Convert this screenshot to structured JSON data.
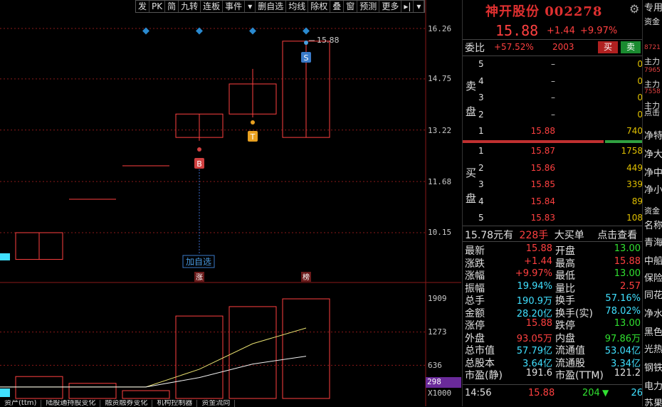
{
  "toolbar": {
    "items": [
      "发",
      "PK",
      "简",
      "九转",
      "连板",
      "事件",
      "▾",
      "删自选",
      "均线",
      "除权",
      "叠",
      "窗",
      "预测",
      "更多",
      "▸|",
      "▾"
    ]
  },
  "chart": {
    "y_labels": [
      "16.26",
      "14.75",
      "13.22",
      "11.68",
      "10.15"
    ],
    "vol_labels": [
      "1909",
      "1273",
      "636"
    ],
    "vol_current": "298",
    "vol_unit": "X1000",
    "high_marker": "15.88",
    "add_watch_label": "加自选",
    "zhang_label": "涨",
    "bang_label": "榜",
    "b_marker": "B",
    "t_marker": "T",
    "s_marker": "S"
  },
  "chart_data": {
    "type": "candlestick",
    "candles": [
      {
        "open": 10.15,
        "close": 9.35,
        "high": 10.15,
        "low": 9.35
      },
      {
        "open": 11.15,
        "close": 11.15,
        "high": 11.15,
        "low": 11.15
      },
      {
        "open": 12.15,
        "close": 12.15,
        "high": 12.15,
        "low": 12.15
      },
      {
        "open": 13.0,
        "close": 13.7,
        "high": 13.7,
        "low": 12.9
      },
      {
        "open": 13.7,
        "close": 14.6,
        "high": 15.05,
        "low": 13.6
      },
      {
        "open": 13.0,
        "close": 15.88,
        "high": 15.88,
        "low": 13.0
      }
    ],
    "volume": [
      420,
      290,
      150,
      1580,
      1760,
      1909
    ],
    "ma_vol_1": [
      220,
      220,
      220,
      560,
      1050,
      1350
    ],
    "ma_vol_2": [
      220,
      220,
      220,
      400,
      660,
      810
    ]
  },
  "header": {
    "stock_name": "神开股份 002278",
    "price": "15.88",
    "change": "+1.44",
    "change_pct": "+9.97%"
  },
  "weibi": {
    "label": "委比",
    "value": "+57.52%",
    "diff": "2003",
    "sell_btn": "买",
    "buy_btn": "卖"
  },
  "orderbook": {
    "sell_label_1": "卖",
    "sell_label_2": "盘",
    "buy_label_1": "买",
    "buy_label_2": "盘",
    "asks": [
      {
        "level": "5",
        "price": "–",
        "vol": "0"
      },
      {
        "level": "4",
        "price": "–",
        "vol": "0"
      },
      {
        "level": "3",
        "price": "–",
        "vol": "0"
      },
      {
        "level": "2",
        "price": "–",
        "vol": "0"
      },
      {
        "level": "1",
        "price": "15.88",
        "vol": "740"
      }
    ],
    "bids": [
      {
        "level": "1",
        "price": "15.87",
        "vol": "1758"
      },
      {
        "level": "2",
        "price": "15.86",
        "vol": "449"
      },
      {
        "level": "3",
        "price": "15.85",
        "vol": "339"
      },
      {
        "level": "4",
        "price": "15.84",
        "vol": "89"
      },
      {
        "level": "5",
        "price": "15.83",
        "vol": "108"
      }
    ]
  },
  "big_order": {
    "amount": "15.78元有",
    "qty": "228手",
    "label": "大买单",
    "link": "点击查看"
  },
  "stats": [
    {
      "l1": "最新",
      "v1": "15.88",
      "c1": "red",
      "l2": "开盘",
      "v2": "13.00",
      "c2": "green"
    },
    {
      "l1": "涨跌",
      "v1": "+1.44",
      "c1": "red",
      "l2": "最高",
      "v2": "15.88",
      "c2": "red"
    },
    {
      "l1": "涨幅",
      "v1": "+9.97%",
      "c1": "red",
      "l2": "最低",
      "v2": "13.00",
      "c2": "green"
    },
    {
      "l1": "振幅",
      "v1": "19.94%",
      "c1": "cyan",
      "l2": "量比",
      "v2": "2.57",
      "c2": "red"
    },
    {
      "l1": "总手",
      "v1": "190.9万",
      "c1": "cyan",
      "l2": "换手",
      "v2": "57.16%",
      "c2": "cyan"
    },
    {
      "l1": "金额",
      "v1": "28.20亿",
      "c1": "cyan",
      "l2": "换手(实)",
      "v2": "78.02%",
      "c2": "cyan"
    },
    {
      "l1": "涨停",
      "v1": "15.88",
      "c1": "red",
      "l2": "跌停",
      "v2": "13.00",
      "c2": "green"
    },
    {
      "l1": "外盘",
      "v1": "93.05万",
      "c1": "red",
      "l2": "内盘",
      "v2": "97.86万",
      "c2": "green"
    },
    {
      "l1": "总市值",
      "v1": "57.79亿",
      "c1": "cyan",
      "l2": "流通值",
      "v2": "53.04亿",
      "c2": "cyan"
    },
    {
      "l1": "总股本",
      "v1": "3.64亿",
      "c1": "cyan",
      "l2": "流通股",
      "v2": "3.34亿",
      "c2": "cyan"
    },
    {
      "l1": "市盈(静)",
      "v1": "191.6",
      "c1": "white",
      "l2": "市盈(TTM)",
      "v2": "121.2",
      "c2": "white"
    }
  ],
  "tick": {
    "time": "14:56",
    "price": "15.88",
    "vol": "204",
    "count": "26"
  },
  "far_right": {
    "items": [
      "专用",
      "资金",
      "8721",
      "主力",
      "7965",
      "主力",
      "7558",
      "主力",
      "点击",
      "净特",
      "净大",
      "净中",
      "净小",
      "资金",
      "名称",
      "青海",
      "中船",
      "保险",
      "同花",
      "净水",
      "黑色",
      "光热",
      "钢铁",
      "电力",
      "苏果"
    ]
  },
  "bottom_tabs": [
    "资产(ttm)",
    "陆股通持股变化",
    "融资融券变化",
    "机构控制器",
    "资金流向"
  ],
  "colors": {
    "up": "#ff4040",
    "down": "#30e030",
    "neutral": "#e0e0e0",
    "cyan": "#40e0ff",
    "yellow": "#e0c000",
    "grid": "#8a1a1a"
  }
}
